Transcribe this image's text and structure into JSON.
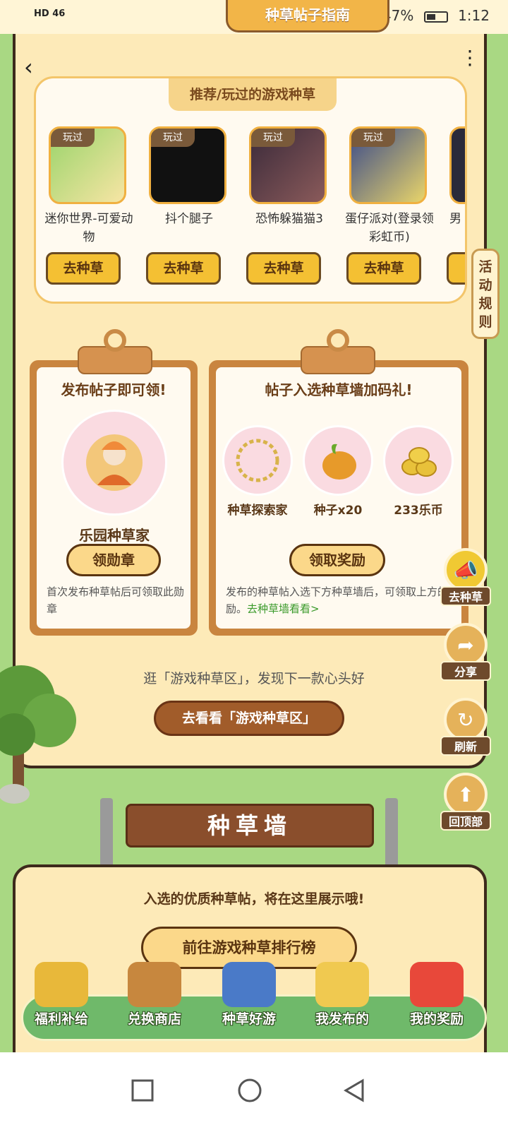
{
  "status_bar": {
    "network": "HD 46",
    "battery": "47%",
    "time": "1:12"
  },
  "header": {
    "guide_tab": "种草帖子指南"
  },
  "recommend": {
    "title": "推荐/玩过的游戏种草",
    "games": [
      {
        "tag": "玩过",
        "name": "迷你世界-可爱动物",
        "button": "去种草"
      },
      {
        "tag": "玩过",
        "name": "抖个腿子",
        "button": "去种草"
      },
      {
        "tag": "玩过",
        "name": "恐怖躲猫猫3",
        "button": "去种草"
      },
      {
        "tag": "玩过",
        "name": "蛋仔派对(登录领彩虹币)",
        "button": "去种草"
      },
      {
        "tag": "",
        "name": "男",
        "button": ""
      }
    ]
  },
  "rules_tab": "活动规则",
  "publish_board": {
    "heading": "发布帖子即可领!",
    "badge_name": "乐园种草家",
    "button": "领勋章",
    "desc": "首次发布种草帖后可领取此勋章"
  },
  "wall_board": {
    "heading": "帖子入选种草墙加码礼!",
    "rewards": [
      {
        "label": "种草探索家"
      },
      {
        "label": "种子x20"
      },
      {
        "label": "233乐币"
      }
    ],
    "button": "领取奖励",
    "desc": "发布的种草帖入选下方种草墙后，可领取上方的奖励。",
    "link": "去种草墙看看>"
  },
  "discover": {
    "text": "逛「游戏种草区」，发现下一款心头好",
    "button": "去看看「游戏种草区」"
  },
  "floats": [
    {
      "label": "去种草",
      "icon": "megaphone-icon"
    },
    {
      "label": "分享",
      "icon": "share-arrow-icon"
    },
    {
      "label": "刷新",
      "icon": "refresh-icon"
    },
    {
      "label": "回顶部",
      "icon": "arrow-up-icon"
    }
  ],
  "wall": {
    "sign": "种草墙",
    "message": "入选的优质种草帖，将在这里展示哦!",
    "rank_button": "前往游戏种草排行榜"
  },
  "bottom_nav": [
    {
      "label": "福利补给"
    },
    {
      "label": "兑换商店"
    },
    {
      "label": "种草好游"
    },
    {
      "label": "我发布的"
    },
    {
      "label": "我的奖励"
    }
  ],
  "colors": {
    "accent": "#f4c033",
    "panel": "#fdeab8",
    "wood": "#c9853f",
    "green": "#6fb96a"
  }
}
